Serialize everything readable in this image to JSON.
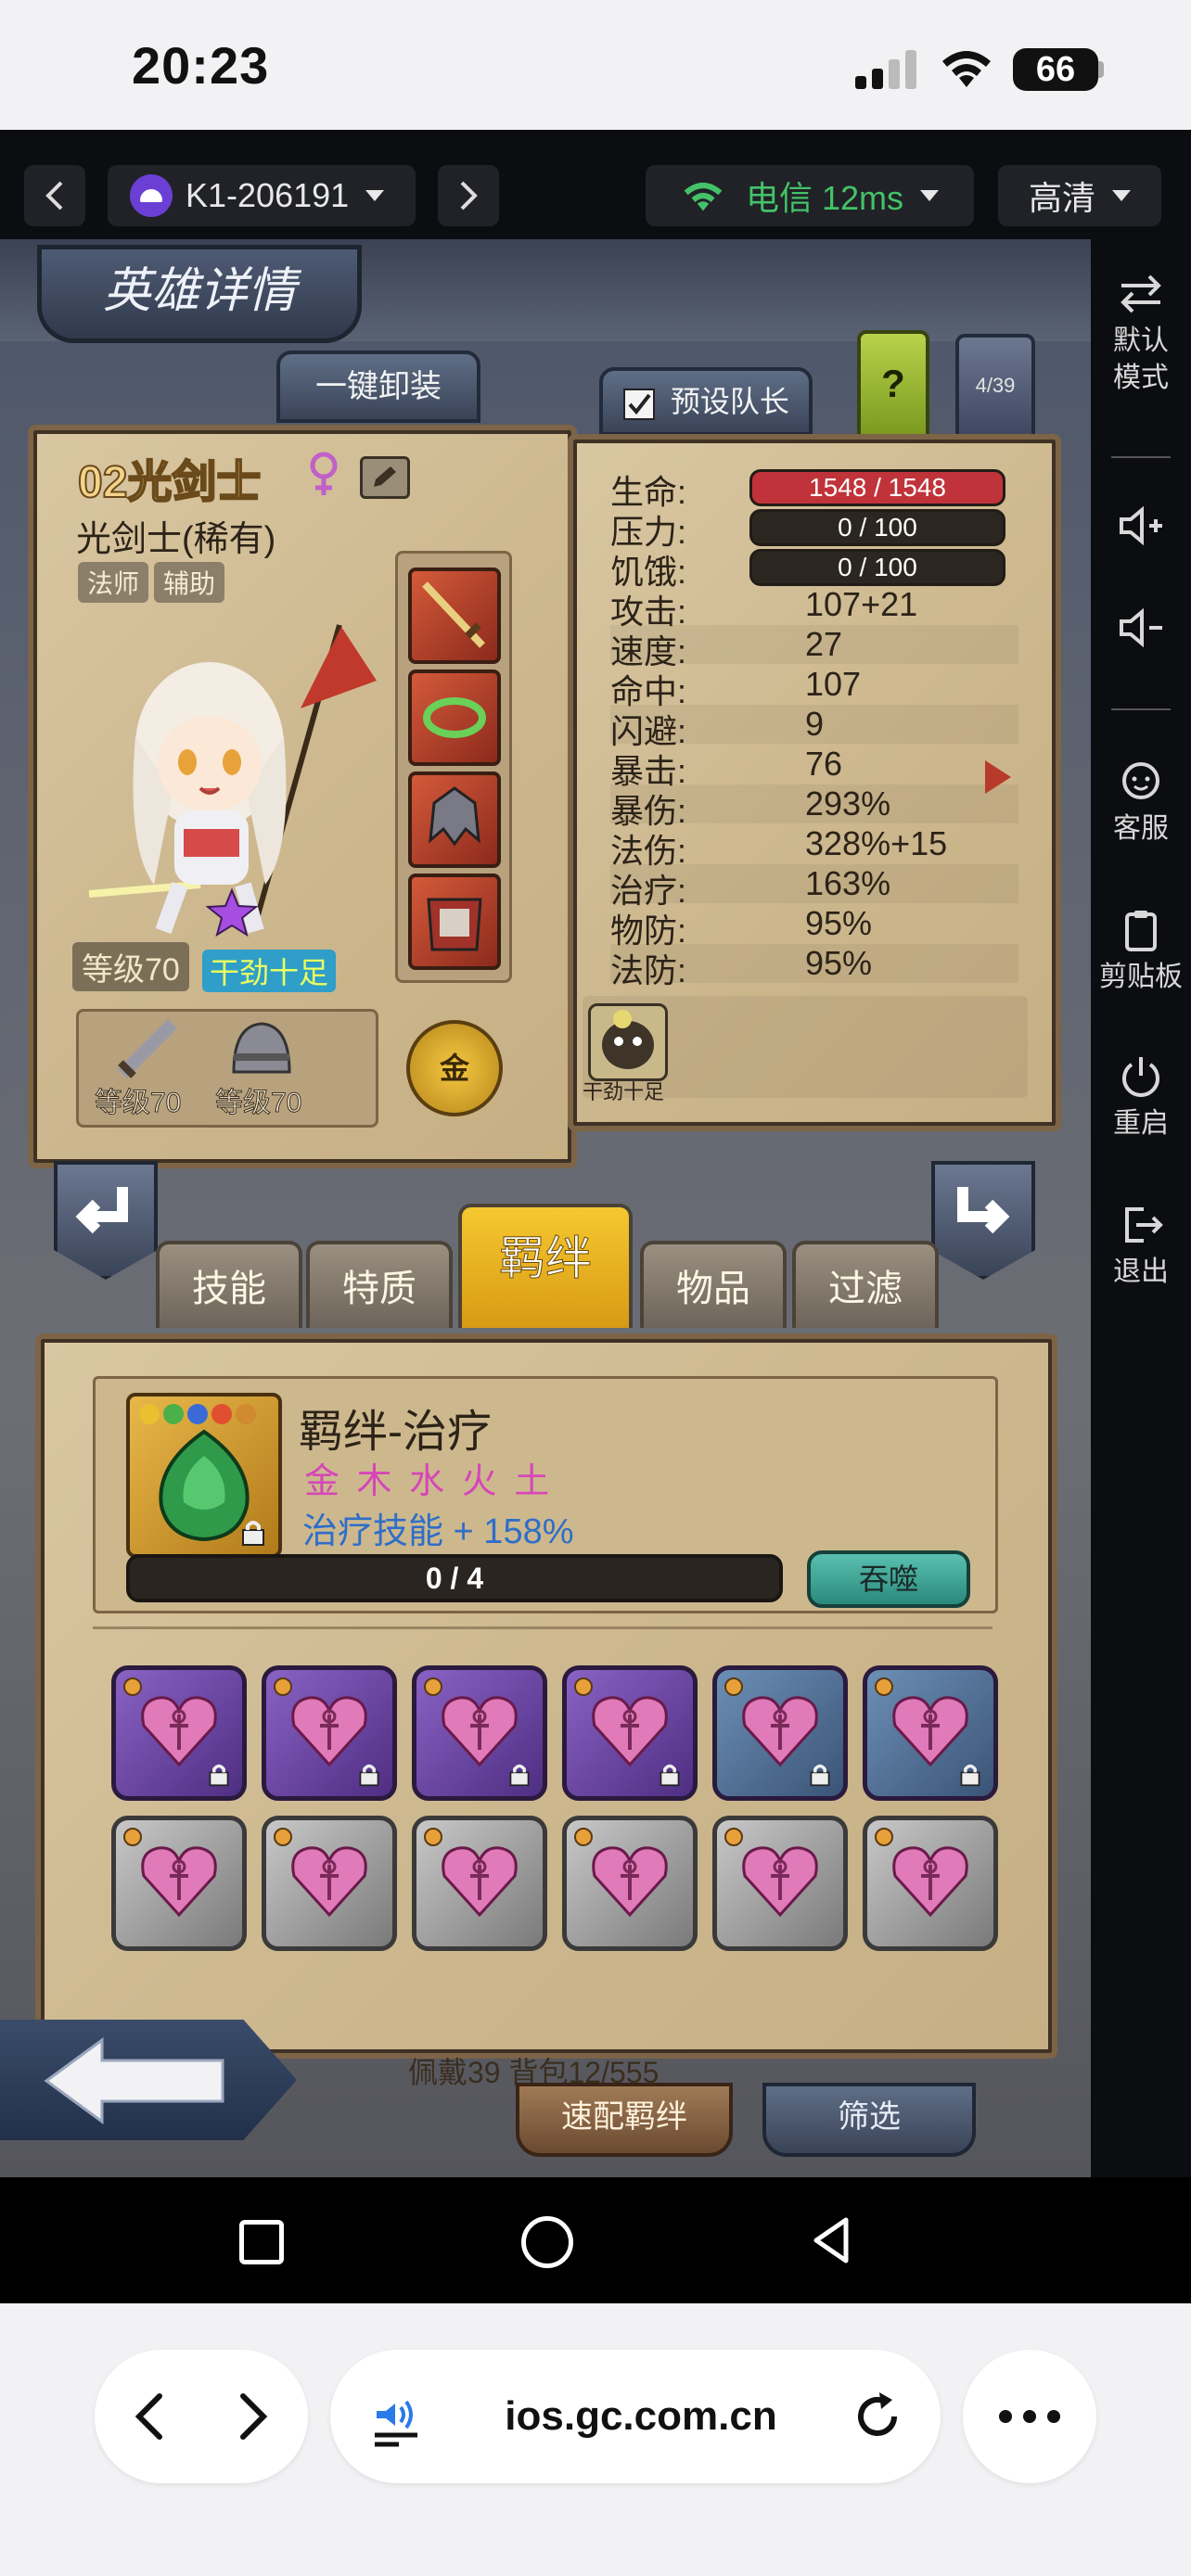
{
  "status_bar": {
    "time": "20:23",
    "battery": "66"
  },
  "toolbar": {
    "device_name": "K1-206191",
    "network_label": "电信 12ms",
    "quality_label": "高清"
  },
  "side_panel": {
    "items": [
      {
        "label": "默认\n模式",
        "icon": "swap-icon"
      },
      {
        "label": "",
        "icon": "volume-up-icon"
      },
      {
        "label": "",
        "icon": "volume-down-icon"
      },
      {
        "label": "客服",
        "icon": "support-icon"
      },
      {
        "label": "剪贴板",
        "icon": "clipboard-icon"
      },
      {
        "label": "重启",
        "icon": "power-icon"
      },
      {
        "label": "退出",
        "icon": "exit-icon"
      }
    ]
  },
  "game": {
    "screen_title": "英雄详情",
    "unequip_all": "一键卸装",
    "preset_leader": "预设队长",
    "help": "?",
    "hero_count": "4/39",
    "hero": {
      "name": "02光剑士",
      "class_name": "光剑士(稀有)",
      "tags": [
        "法师",
        "辅助"
      ],
      "level": "等级70",
      "mood": "干劲十足",
      "equip_levels": [
        "等级70",
        "等级70"
      ],
      "gold_badge": "金"
    },
    "stats": [
      {
        "label": "生命:",
        "value": "1548 / 1548",
        "kind": "bar",
        "color": "#c0333a"
      },
      {
        "label": "压力:",
        "value": "0 / 100",
        "kind": "bar",
        "color": "#2b2620"
      },
      {
        "label": "饥饿:",
        "value": "0 / 100",
        "kind": "bar",
        "color": "#2b2620"
      },
      {
        "label": "攻击:",
        "value": "107+21"
      },
      {
        "label": "速度:",
        "value": "27"
      },
      {
        "label": "命中:",
        "value": "107"
      },
      {
        "label": "闪避:",
        "value": "9"
      },
      {
        "label": "暴击:",
        "value": "76"
      },
      {
        "label": "暴伤:",
        "value": "293%"
      },
      {
        "label": "法伤:",
        "value": "328%+15"
      },
      {
        "label": "治疗:",
        "value": "163%"
      },
      {
        "label": "物防:",
        "value": "95%"
      },
      {
        "label": "法防:",
        "value": "95%"
      }
    ],
    "mood_badge_label": "干劲十足",
    "tabs": [
      "技能",
      "特质",
      "羁绊",
      "物品",
      "过滤"
    ],
    "active_tab": "羁绊",
    "bond": {
      "title": "羁绊-治疗",
      "elements": "金 木 水 火 土",
      "effect": "治疗技能 + 158%",
      "progress_text": "0 / 4",
      "progress": 0,
      "devour": "吞噬"
    },
    "inventory_text": "佩戴39 背包12/555",
    "quick_bond": "速配羁绊",
    "filter": "筛选"
  },
  "browser": {
    "url": "ios.gc.com.cn"
  }
}
